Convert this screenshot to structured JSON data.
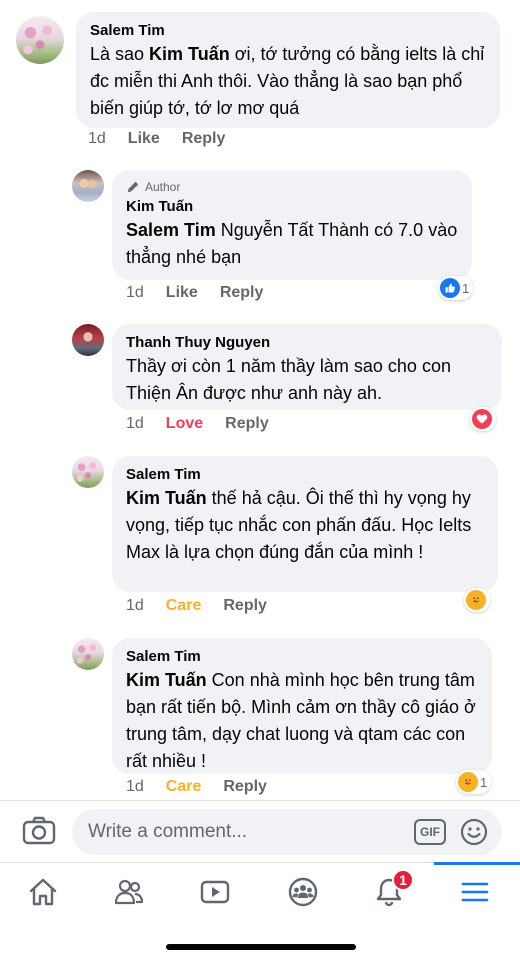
{
  "comments": [
    {
      "author": "Salem Tim",
      "mention": "Kim Tuấn",
      "text_before": "Là sao ",
      "text_after": " ơi, tớ tưởng có bằng ielts là chỉ đc miễn thi Anh thôi. Vào thẳng là sao bạn phổ biến giúp tớ, tớ lơ mơ quá",
      "time": "1d",
      "action": "Like",
      "reply": "Reply"
    },
    {
      "author_badge": "Author",
      "author": "Kim Tuấn",
      "mention": "Salem Tim",
      "text_after": " Nguyễn Tất Thành có 7.0 vào thẳng nhé bạn",
      "time": "1d",
      "action": "Like",
      "reply": "Reply",
      "reaction_icon": "like-icon",
      "reaction_count": "1"
    },
    {
      "author": "Thanh Thuy Nguyen",
      "text": "Thầy ơi còn 1 năm thầy làm sao cho con Thiện Ân được như anh này ah.",
      "time": "1d",
      "action": "Love",
      "reply": "Reply",
      "reaction_icon": "love-icon"
    },
    {
      "author": "Salem Tim",
      "mention": "Kim Tuấn",
      "text_after": " thế hả cậu. Ôi thế thì hy vọng hy vọng, tiếp tục nhắc con phấn đấu. Học Ielts Max là lựa chọn đúng đắn của mình !",
      "time": "1d",
      "action": "Care",
      "reply": "Reply",
      "reaction_icon": "care-icon"
    },
    {
      "author": "Salem Tim",
      "mention": "Kim Tuấn",
      "text_after": " Con nhà mình học bên trung tâm bạn rất tiến bộ. Mình cảm ơn thầy cô giáo ở trung tâm, dạy chat luong và qtam các con rất nhiều !",
      "time": "1d",
      "action": "Care",
      "reply": "Reply",
      "reaction_icon": "care-icon",
      "reaction_count": "1"
    }
  ],
  "composer": {
    "placeholder": "Write a comment...",
    "gif_label": "GIF",
    "camera_icon": "camera-icon",
    "emoji_icon": "smiley-icon"
  },
  "tabs": [
    {
      "icon": "home-icon"
    },
    {
      "icon": "friends-icon"
    },
    {
      "icon": "watch-icon"
    },
    {
      "icon": "groups-icon"
    },
    {
      "icon": "bell-icon",
      "badge": "1"
    },
    {
      "icon": "menu-icon",
      "active": true
    }
  ],
  "colors": {
    "accent": "#1877f2",
    "bubble": "#f0f2f5",
    "meta_text": "#65676b",
    "love": "#f33e58",
    "care": "#f7b125",
    "badge": "#e41e3f"
  }
}
